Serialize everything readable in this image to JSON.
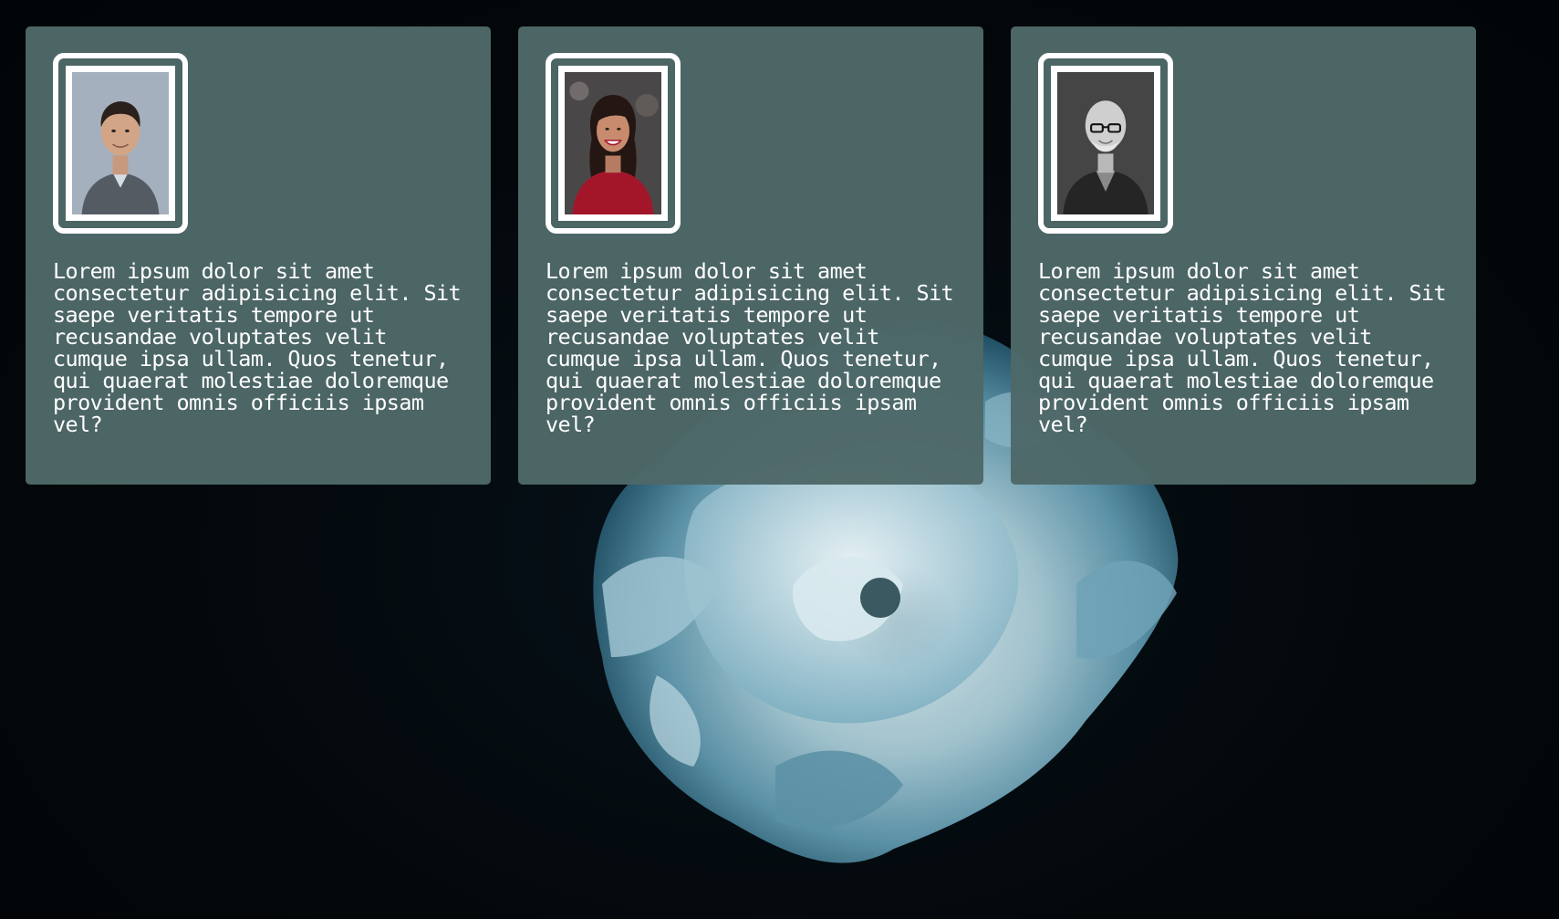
{
  "background": {
    "color": "#030709",
    "image": "blue-rose-icon"
  },
  "cards": [
    {
      "avatar": "man-portrait-icon",
      "text": "Lorem ipsum dolor sit amet consectetur adipisicing elit. Sit saepe veritatis tempore ut recusandae voluptates velit cumque ipsa ullam. Quos tenetur, qui quaerat molestiae doloremque provident omnis officiis ipsam vel?"
    },
    {
      "avatar": "woman-portrait-icon",
      "text": "Lorem ipsum dolor sit amet consectetur adipisicing elit. Sit saepe veritatis tempore ut recusandae voluptates velit cumque ipsa ullam. Quos tenetur, qui quaerat molestiae doloremque provident omnis officiis ipsam vel?"
    },
    {
      "avatar": "bald-man-glasses-portrait-icon",
      "text": "Lorem ipsum dolor sit amet consectetur adipisicing elit. Sit saepe veritatis tempore ut recusandae voluptates velit cumque ipsa ullam. Quos tenetur, qui quaerat molestiae doloremque provident omnis officiis ipsam vel?"
    }
  ],
  "colors": {
    "card": "#4e6868",
    "frame": "#ffffff",
    "text": "#ffffff"
  }
}
